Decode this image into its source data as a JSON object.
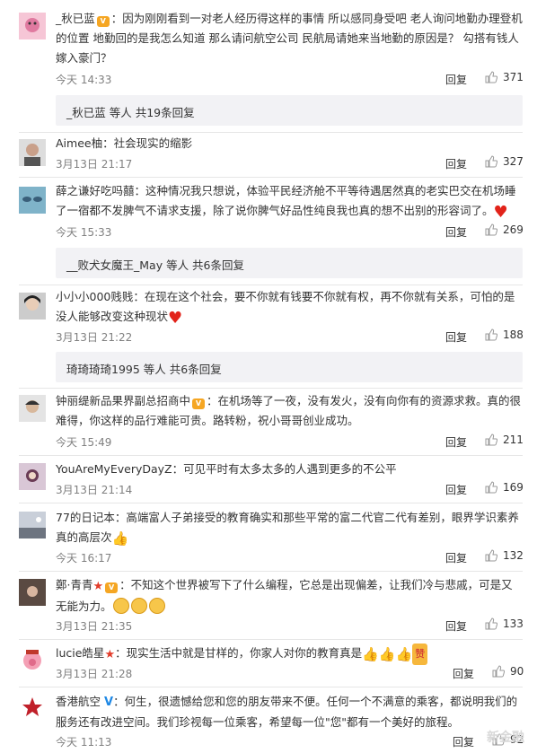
{
  "common": {
    "reply_label": "回复"
  },
  "comments": [
    {
      "user": "_秋已蓝",
      "text": "：因为刚刚看到一对老人经历得这样的事情 所以感同身受吧 老人询问地勤办理登机的位置 地勤回的是我怎么知道 那么请问航空公司 民航局请她来当地勤的原因是？ 勾搭有钱人 嫁入豪门？",
      "time": "今天 14:33",
      "likes": "371",
      "sub": "_秋已蓝  等人 共19条回复"
    },
    {
      "user": "Aimee柚",
      "text": "：社会现实的缩影",
      "time": "3月13日 21:17",
      "likes": "327"
    },
    {
      "user": "薛之谦好吃吗囍",
      "text": "：这种情况我只想说，体验平民经济舱不平等待遇居然真的老实巴交在机场睡了一宿都不发脾气不请求支援，除了说你脾气好品性纯良我也真的想不出别的形容词了。",
      "time": "今天 15:33",
      "likes": "269",
      "sub": "__败犬女魔王_May  等人 共6条回复"
    },
    {
      "user": "小小小000贱贱",
      "text": "：在现在这个社会，要不你就有钱要不你就有权，再不你就有关系，可怕的是没人能够改变这种现状",
      "time": "3月13日 21:22",
      "likes": "188",
      "sub": "琦琦琦琦1995 等人 共6条回复"
    },
    {
      "user": "钟丽缇新品果界副总招商中",
      "text": "：在机场等了一夜，没有发火，没有向你有的资源求救。真的很难得，你这样的品行难能可贵。路转粉，祝小哥哥创业成功。",
      "time": "今天 15:49",
      "likes": "211"
    },
    {
      "user": "YouAreMyEveryDayZ",
      "text": "：可见平时有太多太多的人遇到更多的不公平",
      "time": "3月13日 21:14",
      "likes": "169"
    },
    {
      "user": "77的日记本",
      "text": "：高端富人子弟接受的教育确实和那些平常的富二代官二代有差别，眼界学识素养真的高层次",
      "time": "今天 16:17",
      "likes": "132"
    },
    {
      "user": "鄭·青青",
      "text": "：不知这个世界被写下了什么编程，它总是出现偏差，让我们冷与悲戚，可是又无能为力。",
      "time": "3月13日 21:35",
      "likes": "133"
    },
    {
      "user": "lucie皓星",
      "text": "：现实生活中就是甘样的，你家人对你的教育真是",
      "time": "3月13日 21:28",
      "likes": "90",
      "zan": "赞"
    },
    {
      "user": "香港航空",
      "text": "：何生，很遗憾给您和您的朋友带来不便。任何一个不满意的乘客，都说明我们的服务还有改进空间。我们珍视每一位乘客，希望每一位\"您\"都有一个美好的旅程。",
      "time": "今天 11:13",
      "likes": "92"
    }
  ],
  "watermark": "新金融"
}
